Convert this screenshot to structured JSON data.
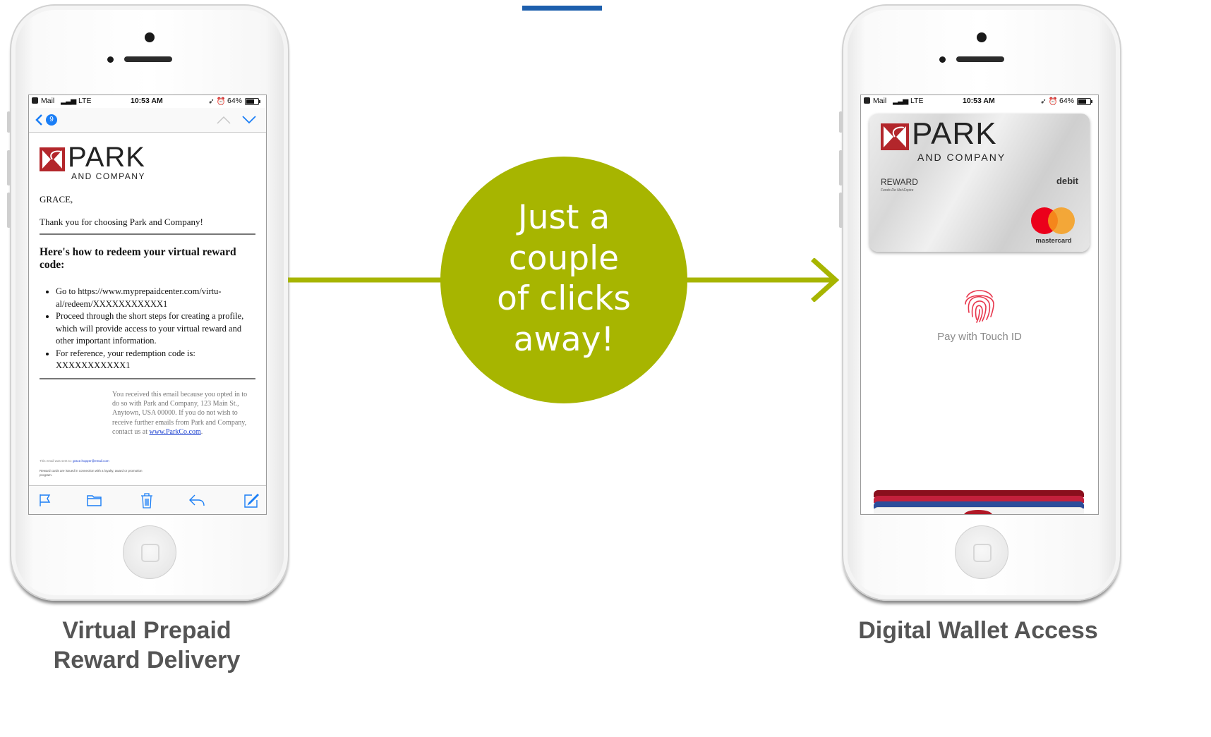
{
  "center": {
    "lines": [
      "Just a",
      "couple",
      "of clicks",
      "away!"
    ]
  },
  "captions": {
    "left_line1": "Virtual Prepaid",
    "left_line2": "Reward Delivery",
    "right": "Digital Wallet Access"
  },
  "status_bar": {
    "app": "Mail",
    "network": "LTE",
    "time": "10:53 AM",
    "battery": "64%"
  },
  "email": {
    "unread_badge": "9",
    "logo": {
      "name": "PARK",
      "sub": "AND COMPANY"
    },
    "greeting": "GRACE,",
    "thanks": "Thank you for choosing Park and Company!",
    "heading": "Here's how to redeem your virtual reward code:",
    "steps": [
      "Go to https://www.myprepaidcenter.com/virtu-al/redeem/XXXXXXXXXXX1",
      "Proceed through the short steps for creating a profile, which will provide access to your virtual reward and other important information.",
      "For reference, your redemption code is: XXXXXXXXXXX1"
    ],
    "footer_text": "You received this email because you opted in to do so with Park and Company, 123 Main St., Anytown, USA 00000. If you do not wish to receive further emails from Park and Company, contact us at",
    "footer_link": "www.ParkCo.com",
    "footer_end": ".",
    "sent_to_label": "This email was sent to:",
    "sent_to_email": "grace.hopper@email.com",
    "disclaimer": "Reward cards are issued in connection with a loyalty, award or promotion program."
  },
  "wallet": {
    "card_logo": {
      "name": "PARK",
      "sub": "AND COMPANY"
    },
    "card_label": "REWARD",
    "card_sublabel": "Funds Do Not Expire",
    "card_type": "debit",
    "network": "mastercard",
    "pay_prompt": "Pay with Touch ID"
  },
  "colors": {
    "accent_green": "#a7b500",
    "top_bar_blue": "#1d5fad",
    "caption_gray": "#555555",
    "brand_red": "#b3262b"
  },
  "icons": [
    "flag-icon",
    "folder-icon",
    "trash-icon",
    "reply-icon",
    "compose-icon",
    "back-chevron-icon",
    "up-chevron-icon",
    "down-chevron-icon",
    "fingerprint-icon",
    "mastercard-logo"
  ]
}
